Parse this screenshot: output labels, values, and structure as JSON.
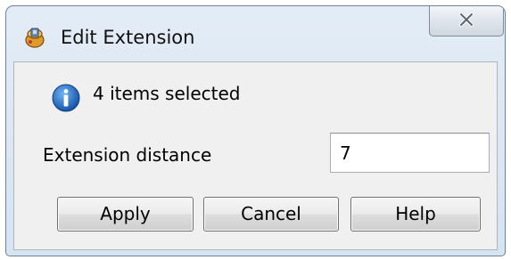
{
  "window": {
    "title": "Edit Extension",
    "app_icon": "application-icon",
    "close_icon": "close-icon"
  },
  "message": {
    "icon": "info-icon",
    "text": "4 items selected"
  },
  "field": {
    "label": "Extension distance",
    "value": "7"
  },
  "buttons": {
    "apply": "Apply",
    "cancel": "Cancel",
    "help": "Help"
  },
  "colors": {
    "frame": "#d6e3f1",
    "client": "#f0f0f0",
    "info_blue": "#1e6fc9"
  }
}
